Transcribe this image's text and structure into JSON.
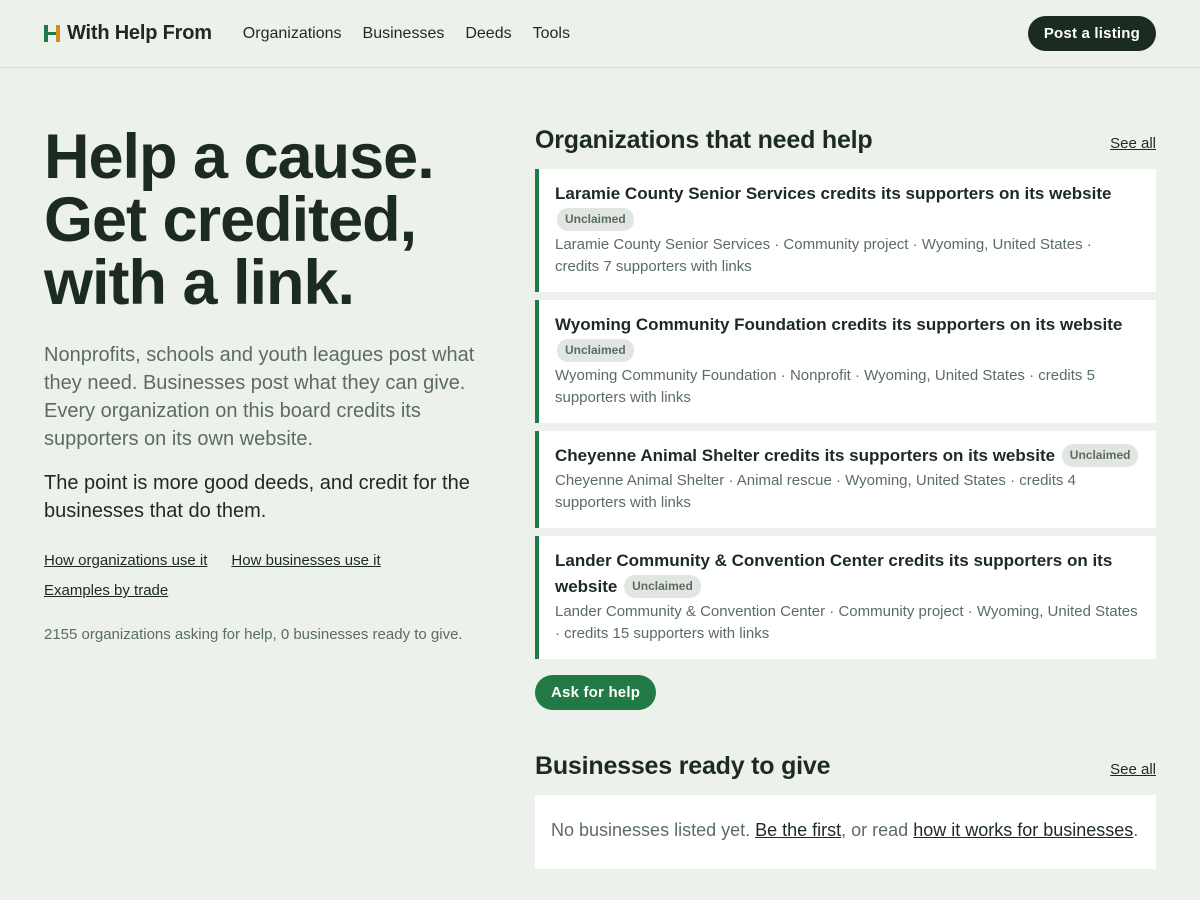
{
  "header": {
    "brand": "With Help From",
    "nav": [
      "Organizations",
      "Businesses",
      "Deeds",
      "Tools"
    ],
    "cta": "Post a listing"
  },
  "hero": {
    "lines": [
      "Help a cause.",
      "Get credited,",
      "with a link."
    ],
    "lede": "Nonprofits, schools and youth leagues post what they need. Businesses post what they can give. Every organization on this board credits its supporters on its own website.",
    "point": "The point is more good deeds, and credit for the businesses that do them.",
    "links": [
      "How organizations use it",
      "How businesses use it",
      "Examples by trade"
    ],
    "stats": "2155 organizations asking for help, 0 businesses ready to give."
  },
  "orgs": {
    "title": "Organizations that need help",
    "see_all": "See all",
    "items": [
      {
        "title": "Laramie County Senior Services credits its supporters on its website",
        "badge": "Unclaimed",
        "meta": "Laramie County Senior Services · Community project · Wyoming, United States · credits 7 supporters with links"
      },
      {
        "title": "Wyoming Community Foundation credits its supporters on its website",
        "badge": "Unclaimed",
        "meta": "Wyoming Community Foundation · Nonprofit · Wyoming, United States · credits 5 supporters with links"
      },
      {
        "title": "Cheyenne Animal Shelter credits its supporters on its website",
        "badge": "Unclaimed",
        "meta": "Cheyenne Animal Shelter · Animal rescue · Wyoming, United States · credits 4 supporters with links"
      },
      {
        "title": "Lander Community & Convention Center credits its supporters on its website",
        "badge": "Unclaimed",
        "meta": "Lander Community & Convention Center · Community project · Wyoming, United States · credits 15 supporters with links"
      }
    ],
    "ask_button": "Ask for help"
  },
  "businesses": {
    "title": "Businesses ready to give",
    "see_all": "See all",
    "empty_prefix": "No businesses listed yet. ",
    "empty_link1": "Be the first",
    "empty_middle": ", or read ",
    "empty_link2": "how it works for businesses",
    "empty_suffix": "."
  },
  "colors": {
    "background": "#ecf1ec",
    "ink": "#1c2b22",
    "accent_green": "#217a45",
    "logo_orange": "#d98a1e",
    "muted": "#5b6d61"
  }
}
